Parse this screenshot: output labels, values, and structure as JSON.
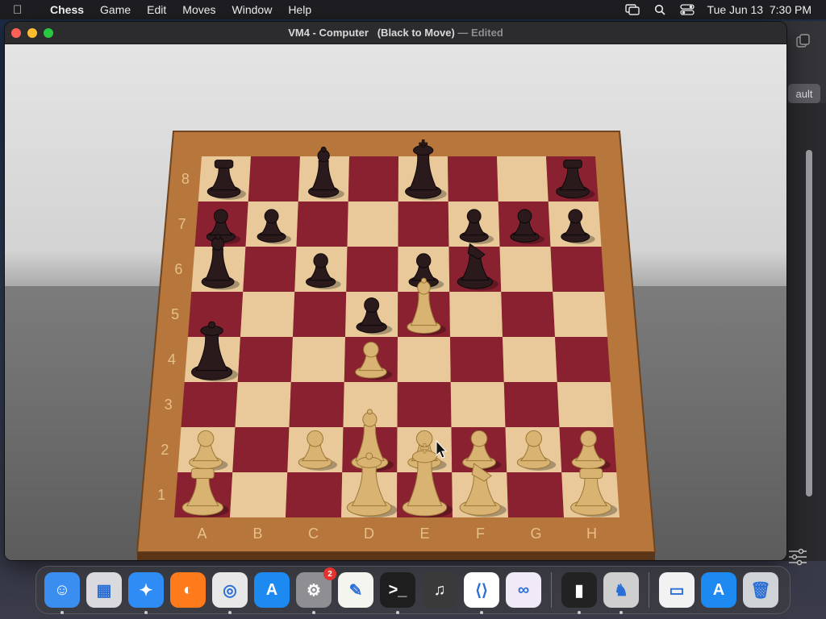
{
  "menubar": {
    "apple_icon": "apple-logo-icon",
    "app_name": "Chess",
    "menus": [
      "Game",
      "Edit",
      "Moves",
      "Window",
      "Help"
    ],
    "status_icons": [
      "screen-mirroring-icon",
      "spotlight-search-icon",
      "control-center-icon"
    ],
    "datetime": "Tue Jun 13  7:30 PM"
  },
  "window": {
    "title": "VM4 - Computer   (Black to Move)",
    "title_separator": "—",
    "title_status": "Edited"
  },
  "back_window": {
    "button_label": "ault"
  },
  "board": {
    "ranks": [
      "8",
      "7",
      "6",
      "5",
      "4",
      "3",
      "2",
      "1"
    ],
    "files": [
      "A",
      "B",
      "C",
      "D",
      "E",
      "F",
      "G",
      "H"
    ],
    "colors": {
      "light": "#e9c999",
      "dark": "#8a2130",
      "frame": "#b7763c",
      "white_piece": "#d9b371",
      "black_piece": "#2a1a1c"
    },
    "pieces": [
      {
        "square": "a8",
        "color": "black",
        "type": "rook"
      },
      {
        "square": "c8",
        "color": "black",
        "type": "bishop"
      },
      {
        "square": "e8",
        "color": "black",
        "type": "king"
      },
      {
        "square": "h8",
        "color": "black",
        "type": "rook"
      },
      {
        "square": "a7",
        "color": "black",
        "type": "pawn"
      },
      {
        "square": "b7",
        "color": "black",
        "type": "pawn"
      },
      {
        "square": "f7",
        "color": "black",
        "type": "pawn"
      },
      {
        "square": "g7",
        "color": "black",
        "type": "pawn"
      },
      {
        "square": "h7",
        "color": "black",
        "type": "pawn"
      },
      {
        "square": "a6",
        "color": "black",
        "type": "bishop"
      },
      {
        "square": "c6",
        "color": "black",
        "type": "pawn"
      },
      {
        "square": "e6",
        "color": "black",
        "type": "pawn"
      },
      {
        "square": "f6",
        "color": "black",
        "type": "knight"
      },
      {
        "square": "d5",
        "color": "black",
        "type": "pawn"
      },
      {
        "square": "a4",
        "color": "black",
        "type": "queen"
      },
      {
        "square": "e5",
        "color": "white",
        "type": "bishop"
      },
      {
        "square": "d4",
        "color": "white",
        "type": "pawn"
      },
      {
        "square": "a2",
        "color": "white",
        "type": "pawn"
      },
      {
        "square": "c2",
        "color": "white",
        "type": "pawn"
      },
      {
        "square": "d2",
        "color": "white",
        "type": "bishop"
      },
      {
        "square": "e2",
        "color": "white",
        "type": "pawn"
      },
      {
        "square": "f2",
        "color": "white",
        "type": "pawn"
      },
      {
        "square": "g2",
        "color": "white",
        "type": "pawn"
      },
      {
        "square": "h2",
        "color": "white",
        "type": "pawn"
      },
      {
        "square": "a1",
        "color": "white",
        "type": "rook"
      },
      {
        "square": "d1",
        "color": "white",
        "type": "queen"
      },
      {
        "square": "e1",
        "color": "white",
        "type": "king"
      },
      {
        "square": "f1",
        "color": "white",
        "type": "knight"
      },
      {
        "square": "h1",
        "color": "white",
        "type": "rook"
      }
    ]
  },
  "dock": {
    "items": [
      {
        "name": "finder-icon",
        "color": "#3a8ef0",
        "glyph": "☺",
        "running": true
      },
      {
        "name": "launchpad-icon",
        "color": "#d9d9de",
        "glyph": "▦",
        "running": false
      },
      {
        "name": "safari-icon",
        "color": "#2f8cf5",
        "glyph": "✦",
        "running": true
      },
      {
        "name": "firefox-icon",
        "color": "#ff7a1a",
        "glyph": "◐",
        "running": false
      },
      {
        "name": "chrome-icon",
        "color": "#e8e8e8",
        "glyph": "◎",
        "running": true
      },
      {
        "name": "app-store-icon",
        "color": "#1d8af2",
        "glyph": "A",
        "running": false
      },
      {
        "name": "system-settings-icon",
        "color": "#8e8e93",
        "glyph": "⚙",
        "running": true,
        "badge": "2"
      },
      {
        "name": "textedit-icon",
        "color": "#f5f5f0",
        "glyph": "✎",
        "running": false
      },
      {
        "name": "terminal-icon",
        "color": "#1e1e1e",
        "glyph": ">_",
        "running": true
      },
      {
        "name": "garageband-icon",
        "color": "#3a3a3a",
        "glyph": "♫",
        "running": false
      },
      {
        "name": "vscode-icon",
        "color": "#ffffff",
        "glyph": "⟨⟩",
        "running": true
      },
      {
        "name": "visual-studio-icon",
        "color": "#f0eaf8",
        "glyph": "∞",
        "running": false
      },
      {
        "name": "piano-icon",
        "color": "#222222",
        "glyph": "▮",
        "running": true
      },
      {
        "name": "chess-icon",
        "color": "#cfcfcf",
        "glyph": "♞",
        "running": true
      },
      {
        "name": "screenshot-window-icon",
        "color": "#f2f2f2",
        "glyph": "▭",
        "running": false
      },
      {
        "name": "app-store-downloads-icon",
        "color": "#1d8af2",
        "glyph": "A",
        "running": false
      },
      {
        "name": "trash-icon",
        "color": "#cfd3d8",
        "glyph": "🗑",
        "running": false
      }
    ]
  }
}
